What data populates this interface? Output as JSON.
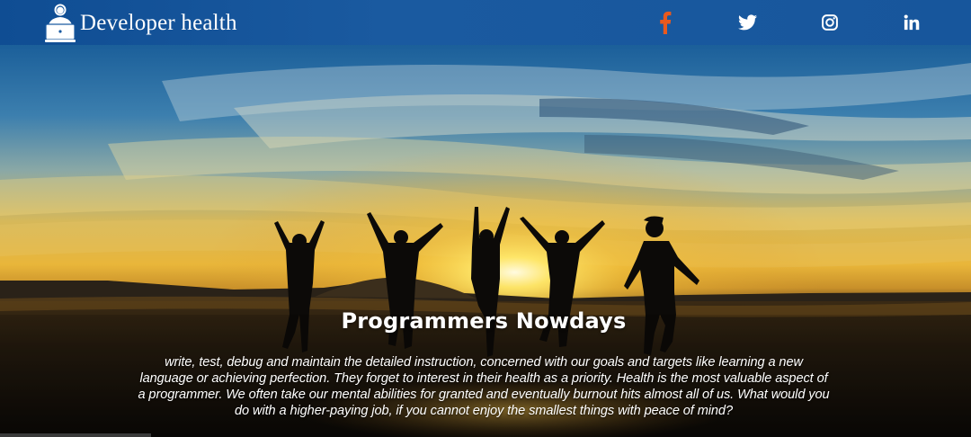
{
  "navbar": {
    "brand_name": "Developer health",
    "background": "#1a5aa0",
    "logo_icon": "developer-laptop-icon",
    "social": [
      {
        "name": "facebook",
        "icon": "facebook-icon",
        "color": "#e8591d"
      },
      {
        "name": "twitter",
        "icon": "twitter-icon",
        "color": "#ffffff"
      },
      {
        "name": "instagram",
        "icon": "instagram-icon",
        "color": "#ffffff"
      },
      {
        "name": "linkedin",
        "icon": "linkedin-icon",
        "color": "#ffffff"
      }
    ]
  },
  "hero": {
    "image": "sunset-beach-jumping-people",
    "title": "Programmers Nowdays",
    "text": "write, test, debug and maintain the detailed instruction, concerned with our goals and targets like learning a new language or achieving perfection. They forget to interest in their health as a priority. Health is the most valuable aspect of a programmer. We often take our mental abilities for granted and eventually burnout hits almost all of us. What would you do with a higher-paying job, if you cannot enjoy the smallest things with peace of mind?"
  }
}
